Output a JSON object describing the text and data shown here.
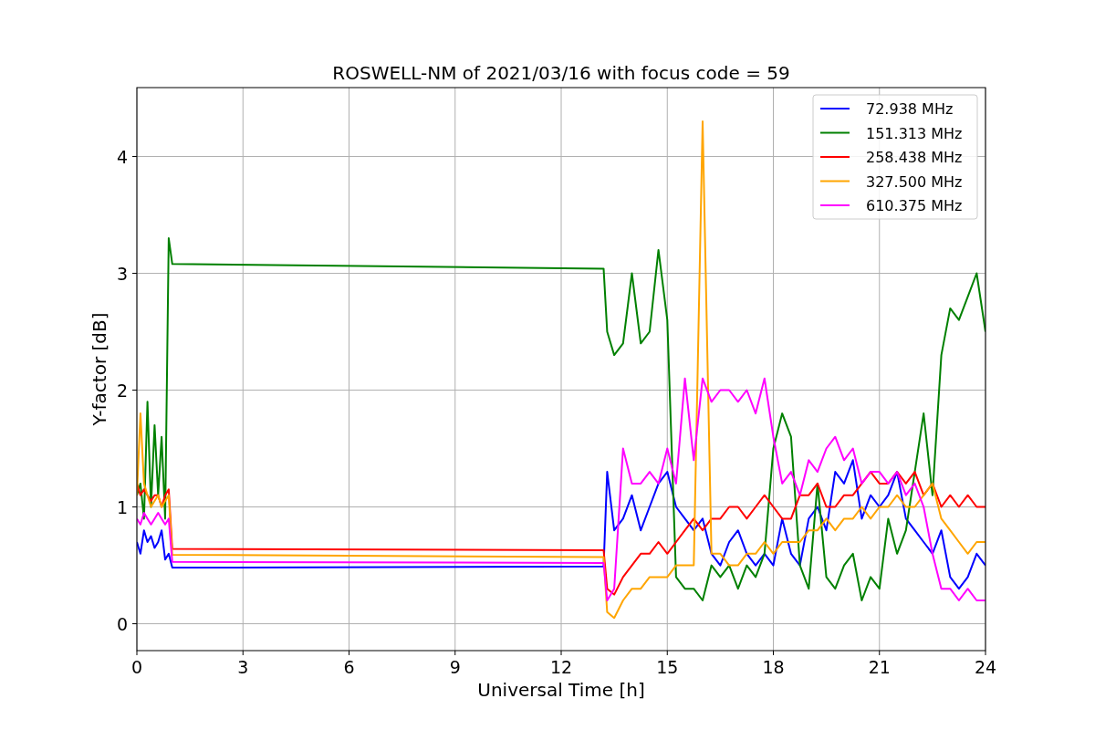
{
  "figure": {
    "chart_data": {
      "type": "line",
      "title": "ROSWELL-NM of 2021/03/16 with focus code = 59",
      "xlabel": "Universal Time [h]",
      "ylabel": "Y-factor [dB]",
      "x": [
        0,
        0.1,
        0.2,
        0.3,
        0.4,
        0.5,
        0.6,
        0.7,
        0.8,
        0.9,
        1,
        13.2,
        13.3,
        13.5,
        13.75,
        14,
        14.25,
        14.5,
        14.75,
        15,
        15.25,
        15.5,
        15.75,
        16,
        16.25,
        16.5,
        16.75,
        17,
        17.25,
        17.5,
        17.75,
        18,
        18.25,
        18.5,
        18.75,
        19,
        19.25,
        19.5,
        19.75,
        20,
        20.25,
        20.5,
        20.75,
        21,
        21.25,
        21.5,
        21.75,
        22,
        22.25,
        22.5,
        22.75,
        23,
        23.25,
        23.5,
        23.75,
        24
      ],
      "series": [
        {
          "name": "72.938 MHz",
          "color": "#0000ff",
          "values": [
            0.7,
            0.6,
            0.8,
            0.7,
            0.75,
            0.65,
            0.7,
            0.8,
            0.55,
            0.6,
            0.48,
            0.49,
            1.3,
            0.8,
            0.9,
            1.1,
            0.8,
            1.0,
            1.2,
            1.3,
            1.0,
            0.9,
            0.8,
            0.9,
            0.6,
            0.5,
            0.7,
            0.8,
            0.6,
            0.5,
            0.6,
            0.5,
            0.9,
            0.6,
            0.5,
            0.9,
            1.0,
            0.8,
            1.3,
            1.2,
            1.4,
            0.9,
            1.1,
            1.0,
            1.1,
            1.3,
            0.9,
            0.8,
            0.7,
            0.6,
            0.8,
            0.4,
            0.3,
            0.4,
            0.6,
            0.5
          ]
        },
        {
          "name": "151.313 MHz",
          "color": "#008000",
          "values": [
            1.1,
            1.2,
            0.9,
            1.9,
            1.0,
            1.7,
            1.1,
            1.6,
            0.9,
            3.3,
            3.08,
            3.04,
            2.5,
            2.3,
            2.4,
            3.0,
            2.4,
            2.5,
            3.2,
            2.6,
            0.4,
            0.3,
            0.3,
            0.2,
            0.5,
            0.4,
            0.5,
            0.3,
            0.5,
            0.4,
            0.6,
            1.5,
            1.8,
            1.6,
            0.5,
            0.3,
            1.2,
            0.4,
            0.3,
            0.5,
            0.6,
            0.2,
            0.4,
            0.3,
            0.9,
            0.6,
            0.8,
            1.3,
            1.8,
            1.1,
            2.3,
            2.7,
            2.6,
            2.8,
            3.0,
            2.5
          ]
        },
        {
          "name": "258.438 MHz",
          "color": "#ff0000",
          "values": [
            1.2,
            1.1,
            1.15,
            1.1,
            1.05,
            1.1,
            1.1,
            1.0,
            1.1,
            1.15,
            0.64,
            0.63,
            0.3,
            0.25,
            0.4,
            0.5,
            0.6,
            0.6,
            0.7,
            0.6,
            0.7,
            0.8,
            0.9,
            0.8,
            0.9,
            0.9,
            1.0,
            1.0,
            0.9,
            1.0,
            1.1,
            1.0,
            0.9,
            0.9,
            1.1,
            1.1,
            1.2,
            1.0,
            1.0,
            1.1,
            1.1,
            1.2,
            1.3,
            1.2,
            1.2,
            1.3,
            1.2,
            1.3,
            1.1,
            1.2,
            1.0,
            1.1,
            1.0,
            1.1,
            1.0,
            1.0
          ]
        },
        {
          "name": "327.500 MHz",
          "color": "#ffa500",
          "values": [
            1.1,
            1.8,
            1.2,
            1.1,
            1.0,
            1.05,
            1.1,
            1.0,
            1.05,
            1.1,
            0.59,
            0.57,
            0.1,
            0.05,
            0.2,
            0.3,
            0.3,
            0.4,
            0.4,
            0.4,
            0.5,
            0.5,
            0.5,
            4.3,
            0.6,
            0.6,
            0.5,
            0.5,
            0.6,
            0.6,
            0.7,
            0.6,
            0.7,
            0.7,
            0.7,
            0.8,
            0.8,
            0.9,
            0.8,
            0.9,
            0.9,
            1.0,
            0.9,
            1.0,
            1.0,
            1.1,
            1.0,
            1.0,
            1.1,
            1.2,
            0.9,
            0.8,
            0.7,
            0.6,
            0.7,
            0.7
          ]
        },
        {
          "name": "610.375 MHz",
          "color": "#ff00ff",
          "values": [
            0.9,
            0.85,
            0.95,
            0.9,
            0.85,
            0.9,
            0.95,
            0.9,
            0.85,
            0.9,
            0.53,
            0.52,
            0.2,
            0.3,
            1.5,
            1.2,
            1.2,
            1.3,
            1.2,
            1.5,
            1.2,
            2.1,
            1.4,
            2.1,
            1.9,
            2.0,
            2.0,
            1.9,
            2.0,
            1.8,
            2.1,
            1.6,
            1.2,
            1.3,
            1.1,
            1.4,
            1.3,
            1.5,
            1.6,
            1.4,
            1.5,
            1.2,
            1.3,
            1.3,
            1.2,
            1.3,
            1.1,
            1.2,
            1.0,
            0.6,
            0.3,
            0.3,
            0.2,
            0.3,
            0.2,
            0.2
          ]
        }
      ],
      "grid": true,
      "legend": true,
      "xlim": [
        0,
        24
      ],
      "ylim": [
        -0.23,
        4.59
      ],
      "xticks": [
        0,
        3,
        6,
        9,
        12,
        15,
        18,
        21,
        24
      ],
      "yticks": [
        0,
        1,
        2,
        3,
        4
      ]
    }
  }
}
